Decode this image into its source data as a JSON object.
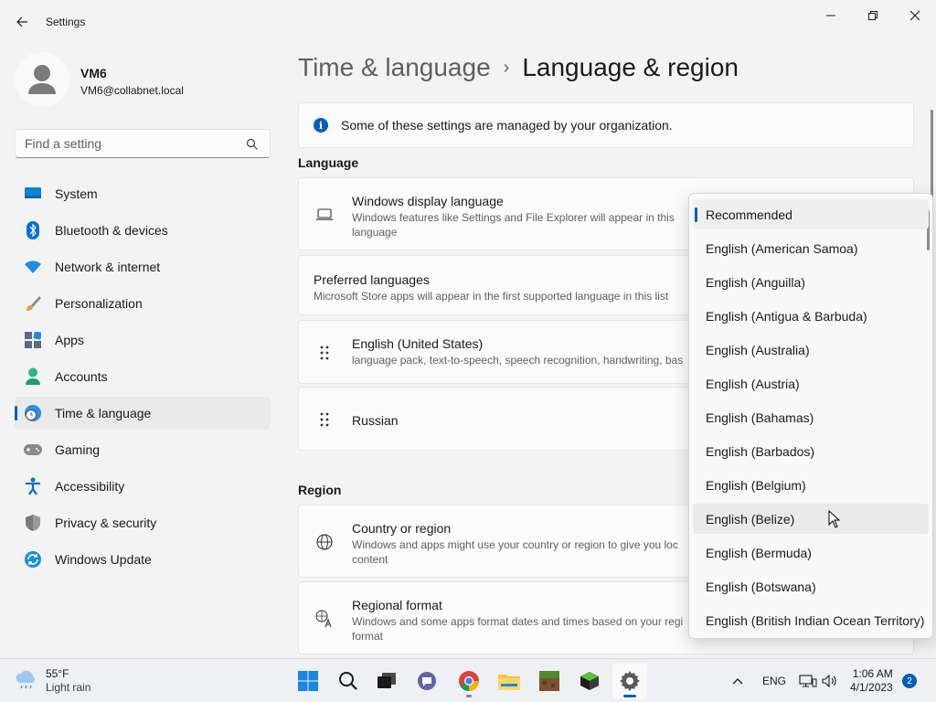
{
  "window": {
    "app_title": "Settings",
    "back_icon": "arrow-left-icon",
    "controls": [
      "minimize-icon",
      "maximize-icon",
      "close-icon"
    ]
  },
  "profile": {
    "name": "VM6",
    "email": "VM6@collabnet.local"
  },
  "search": {
    "placeholder": "Find a setting",
    "icon": "search-icon"
  },
  "sidebar": {
    "items": [
      {
        "label": "System",
        "icon": "monitor-icon"
      },
      {
        "label": "Bluetooth & devices",
        "icon": "bluetooth-icon"
      },
      {
        "label": "Network & internet",
        "icon": "wifi-icon"
      },
      {
        "label": "Personalization",
        "icon": "paintbrush-icon"
      },
      {
        "label": "Apps",
        "icon": "apps-icon"
      },
      {
        "label": "Accounts",
        "icon": "person-icon"
      },
      {
        "label": "Time & language",
        "icon": "globe-clock-icon",
        "selected": true
      },
      {
        "label": "Gaming",
        "icon": "gamepad-icon"
      },
      {
        "label": "Accessibility",
        "icon": "accessibility-icon"
      },
      {
        "label": "Privacy & security",
        "icon": "shield-icon"
      },
      {
        "label": "Windows Update",
        "icon": "update-icon"
      }
    ]
  },
  "main": {
    "breadcrumb": {
      "parent": "Time & language",
      "separator": "›",
      "current": "Language & region"
    },
    "banner": {
      "text": "Some of these settings are managed by your organization.",
      "icon": "info-icon"
    },
    "language_section": {
      "title": "Language",
      "display_language": {
        "title": "Windows display language",
        "description": "Windows features like Settings and File Explorer will appear in this language",
        "icon": "laptop-icon"
      },
      "preferred": {
        "title": "Preferred languages",
        "description": "Microsoft Store apps will appear in the first supported language in this list"
      },
      "languages": [
        {
          "name": "English (United States)",
          "detail": "language pack, text-to-speech, speech recognition, handwriting, bas",
          "icon": "drag-handle-icon"
        },
        {
          "name": "Russian",
          "detail": "",
          "icon": "drag-handle-icon"
        }
      ]
    },
    "region_section": {
      "title": "Region",
      "country": {
        "title": "Country or region",
        "description": "Windows and apps might use your country or region to give you loc content",
        "icon": "globe-icon"
      },
      "format": {
        "title": "Regional format",
        "description": "Windows and some apps format dates and times based on your regi format",
        "icon": "language-format-icon"
      }
    }
  },
  "dropdown": {
    "selected_index": 0,
    "hover_index": 9,
    "options": [
      "Recommended",
      "English (American Samoa)",
      "English (Anguilla)",
      "English (Antigua & Barbuda)",
      "English (Australia)",
      "English (Austria)",
      "English (Bahamas)",
      "English (Barbados)",
      "English (Belgium)",
      "English (Belize)",
      "English (Bermuda)",
      "English (Botswana)",
      "English (British Indian Ocean Territory)"
    ]
  },
  "taskbar": {
    "weather": {
      "temp": "55°F",
      "condition": "Light rain",
      "icon": "cloud-rain-icon"
    },
    "apps": [
      {
        "icon": "windows-start-icon"
      },
      {
        "icon": "search-icon"
      },
      {
        "icon": "task-view-icon"
      },
      {
        "icon": "teams-chat-icon"
      },
      {
        "icon": "chrome-icon"
      },
      {
        "icon": "file-explorer-icon"
      },
      {
        "icon": "minecraft-icon"
      },
      {
        "icon": "minecraft-education-icon"
      },
      {
        "icon": "settings-gear-icon",
        "active": true
      }
    ],
    "tray": {
      "chevron": "chevron-up-icon",
      "lang": "ENG",
      "icons": [
        "network-icon",
        "volume-icon"
      ]
    },
    "clock": {
      "time": "1:06 AM",
      "date": "4/1/2023"
    },
    "notifications": "2"
  },
  "colors": {
    "accent": "#005fb8",
    "background": "#f3f3f3",
    "card": "#fbfbfb"
  }
}
